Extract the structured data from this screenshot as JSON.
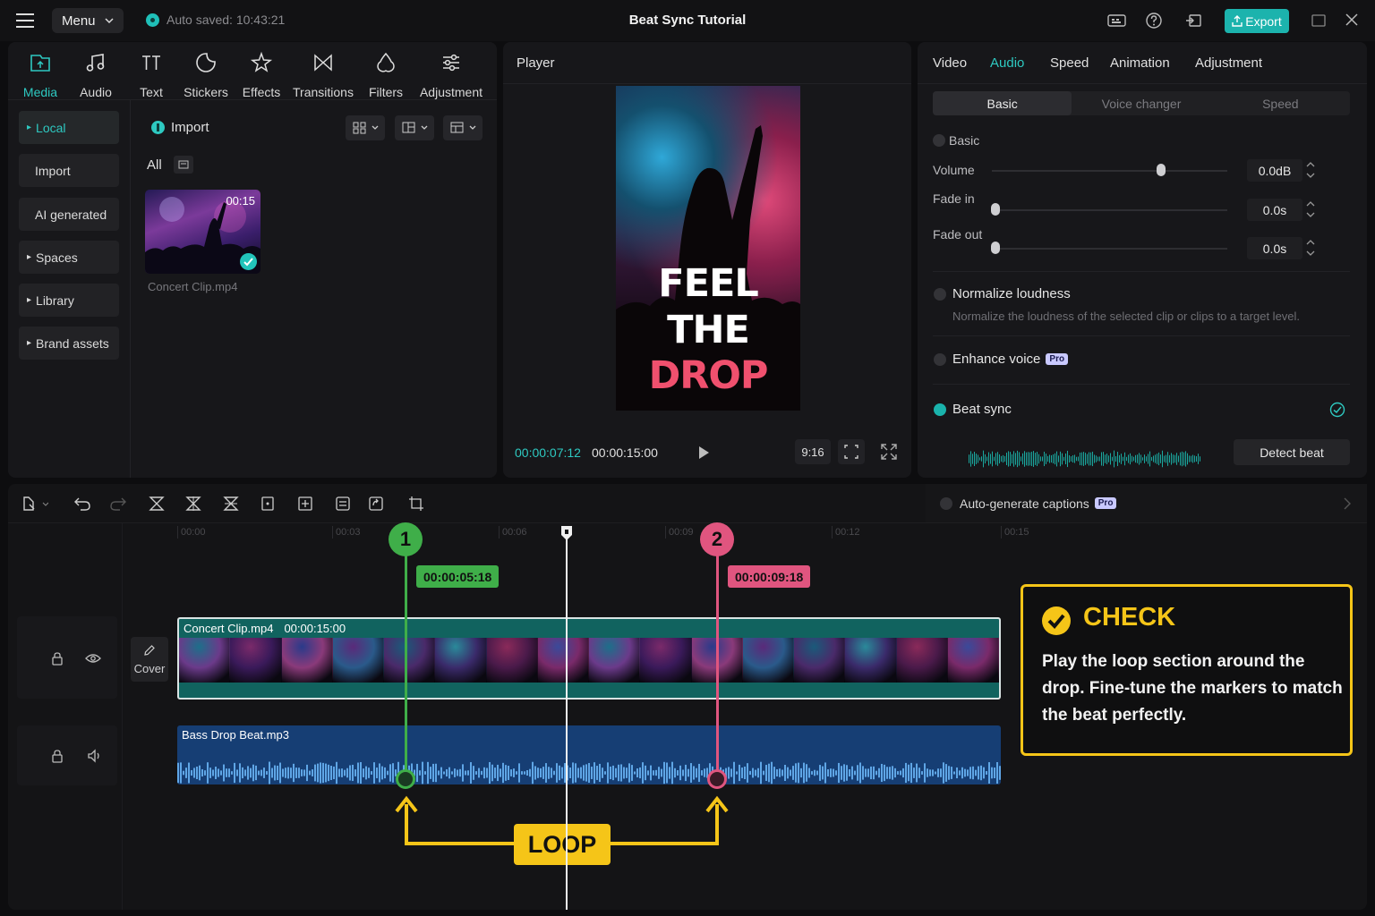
{
  "topbar": {
    "menu_label": "Menu",
    "autosave": "Auto saved: 10:43:21",
    "title": "Beat Sync Tutorial",
    "export_label": "Export"
  },
  "media_panel": {
    "tools": [
      {
        "label": "Media",
        "icon": "media-icon"
      },
      {
        "label": "Audio",
        "icon": "music-note-icon"
      },
      {
        "label": "Text",
        "icon": "text-icon"
      },
      {
        "label": "Stickers",
        "icon": "sticker-icon"
      },
      {
        "label": "Effects",
        "icon": "sparkle-icon"
      },
      {
        "label": "Transitions",
        "icon": "transition-icon"
      },
      {
        "label": "Filters",
        "icon": "filter-icon"
      },
      {
        "label": "Adjustment",
        "icon": "sliders-icon"
      }
    ],
    "sidebar": [
      "Local",
      "Import",
      "AI generated",
      "Spaces",
      "Library",
      "Brand assets"
    ],
    "import_label": "Import",
    "filter_all": "All",
    "clip": {
      "duration": "00:15",
      "name": "Concert Clip.mp4"
    }
  },
  "player": {
    "label": "Player",
    "overlay_lines": [
      "FEEL",
      "THE",
      "DROP"
    ],
    "current_time": "00:00:07:12",
    "total_time": "00:00:15:00",
    "aspect": "9:16"
  },
  "inspector": {
    "tabs": [
      "Video",
      "Audio",
      "Speed",
      "Animation",
      "Adjustment"
    ],
    "active_tab": "Audio",
    "subtabs": [
      "Basic",
      "Voice changer",
      "Speed"
    ],
    "basic_label": "Basic",
    "volume": {
      "label": "Volume",
      "value": "0.0dB",
      "level": 0.72
    },
    "fade_in": {
      "label": "Fade in",
      "value": "0.0s",
      "level": 0.0
    },
    "fade_out": {
      "label": "Fade out",
      "value": "0.0s",
      "level": 0.0
    },
    "normalize": {
      "title": "Normalize loudness",
      "desc": "Normalize the loudness of the selected clip or clips to a target level."
    },
    "enhance": {
      "title": "Enhance voice",
      "badge": "Pro"
    },
    "beat_sync": {
      "title": "Beat sync",
      "detect_label": "Detect beat"
    }
  },
  "timeline": {
    "captions_label": "Auto-generate captions",
    "captions_badge": "Pro",
    "ruler": [
      "00:00",
      "00:03",
      "00:06",
      "00:09",
      "00:12",
      "00:15"
    ],
    "cover_label": "Cover",
    "video_clip": {
      "name": "Concert Clip.mp4",
      "duration": "00:00:15:00"
    },
    "audio_clip": {
      "name": "Bass Drop Beat.mp3"
    },
    "markers": [
      {
        "number": "1",
        "time": "00:00:05:18",
        "color": "#3fae49"
      },
      {
        "number": "2",
        "time": "00:00:09:18",
        "color": "#e0557f"
      }
    ],
    "loop_label": "LOOP"
  },
  "callout": {
    "title": "CHECK",
    "body": "Play the loop section around the drop. Fine-tune the markers to match the beat perfectly."
  },
  "colors": {
    "accent": "#2ec9c1",
    "highlight": "#f5c518"
  }
}
